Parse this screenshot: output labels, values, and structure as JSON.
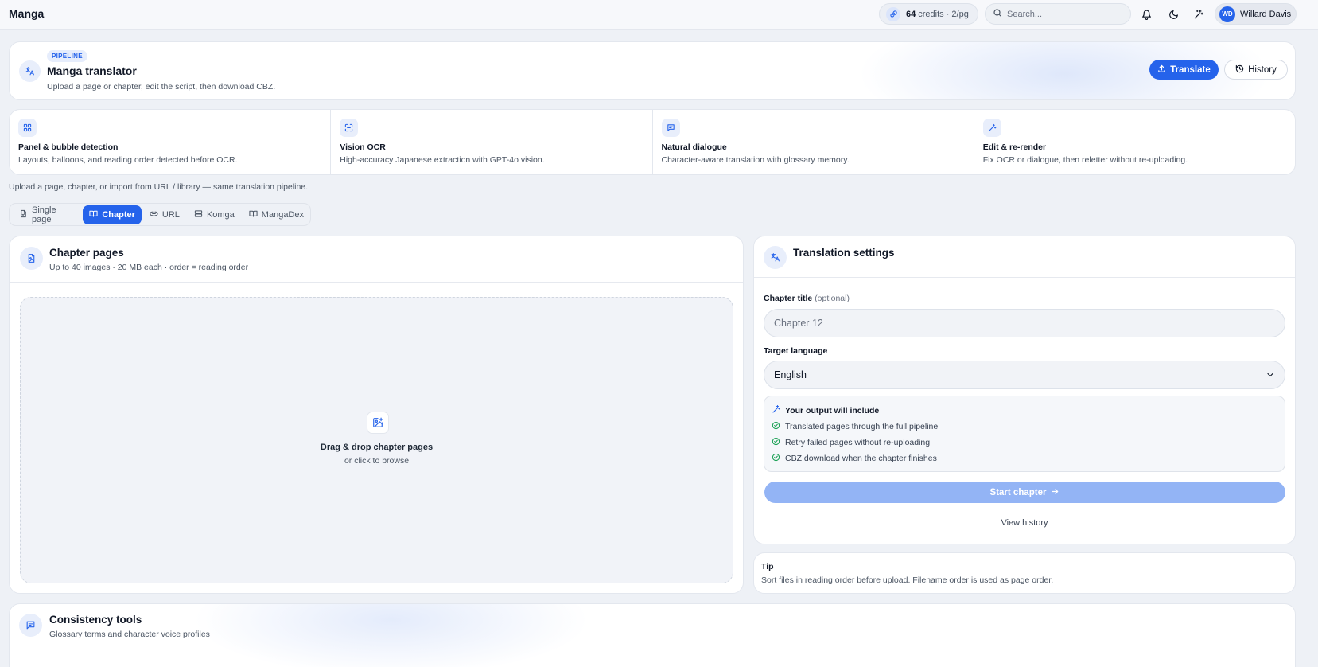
{
  "app": {
    "title": "Manga"
  },
  "topbar": {
    "credits_value": "64",
    "credits_suffix": "credits · 2/pg",
    "search_placeholder": "Search...",
    "user_initials": "WD",
    "user_name": "Willard Davis"
  },
  "hero": {
    "tag": "PIPELINE",
    "title": "Manga translator",
    "subtitle": "Upload a page or chapter, edit the script, then download CBZ.",
    "translate_label": "Translate",
    "history_label": "History"
  },
  "features": [
    {
      "icon": "grid-icon",
      "title": "Panel & bubble detection",
      "desc": "Layouts, balloons, and reading order detected before OCR."
    },
    {
      "icon": "scan-icon",
      "title": "Vision OCR",
      "desc": "High-accuracy Japanese extraction with GPT-4o vision."
    },
    {
      "icon": "message-icon",
      "title": "Natural dialogue",
      "desc": "Character-aware translation with glossary memory."
    },
    {
      "icon": "wand-icon",
      "title": "Edit & re-render",
      "desc": "Fix OCR or dialogue, then reletter without re-uploading."
    }
  ],
  "intro_text": "Upload a page, chapter, or import from URL / library — same translation pipeline.",
  "tabs": [
    {
      "label": "Single page",
      "active": false
    },
    {
      "label": "Chapter",
      "active": true
    },
    {
      "label": "URL",
      "active": false
    },
    {
      "label": "Komga",
      "active": false
    },
    {
      "label": "MangaDex",
      "active": false
    }
  ],
  "chapter_pages": {
    "title": "Chapter pages",
    "subtitle": "Up to 40 images · 20 MB each · order = reading order",
    "drop_title": "Drag & drop chapter pages",
    "drop_sub": "or click to browse"
  },
  "settings": {
    "title": "Translation settings",
    "chapter_title_label": "Chapter title",
    "chapter_title_optional": "(optional)",
    "chapter_title_placeholder": "Chapter 12",
    "target_language_label": "Target language",
    "target_language_value": "English",
    "output_title": "Your output will include",
    "output_items": [
      "Translated pages through the full pipeline",
      "Retry failed pages without re-uploading",
      "CBZ download when the chapter finishes"
    ],
    "start_label": "Start chapter",
    "view_history_label": "View history"
  },
  "tip": {
    "title": "Tip",
    "text": "Sort files in reading order before upload. Filename order is used as page order."
  },
  "consistency": {
    "title": "Consistency tools",
    "subtitle": "Glossary terms and character voice profiles"
  },
  "colors": {
    "accent": "#2563eb",
    "accent_disabled": "#93b4f5",
    "success": "#22a35a",
    "background": "#eef1f6"
  }
}
